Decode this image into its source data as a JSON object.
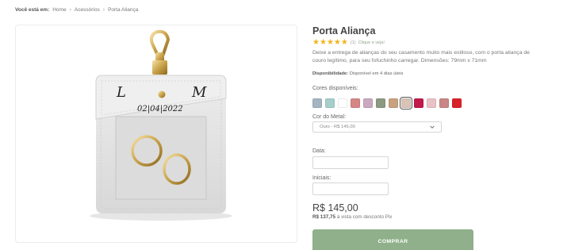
{
  "breadcrumb": {
    "lead": "Você está em:",
    "items": [
      "Home",
      "Acessórios",
      "Porta Aliança"
    ]
  },
  "product": {
    "title": "Porta Aliança",
    "rating": {
      "stars": 5,
      "count": "(1)",
      "review_link": "Clique e veja!"
    },
    "description": "Deixe a entrega de alianças do seu casamento muito mais estiloso, com o porta aliança de couro legítimo, para seu fofuchinho carregar. Dimensões: 79mm x 71mm",
    "availability_label": "Disponibilidade:",
    "availability_value": "Disponível em 4 dias úteis",
    "image_engraving": {
      "initial_left": "L",
      "initial_right": "M",
      "date": "02|04|2022"
    }
  },
  "colors": {
    "label": "Cores disponíveis:",
    "selected_index": 7,
    "swatches": [
      "#a5b4c2",
      "#a6cfcb",
      "#ffffff",
      "#d68585",
      "#c9a9bf",
      "#8c9a82",
      "#c9a17f",
      "#d9c4b5",
      "#c21a4a",
      "#e8c2c4",
      "#c98686",
      "#d92128"
    ]
  },
  "metal": {
    "label": "Cor do Metal:",
    "value": "Ouro - R$ 145,00"
  },
  "fields": {
    "date_label": "Data:",
    "date_value": "",
    "initials_label": "Iniciais:",
    "initials_value": ""
  },
  "pricing": {
    "price": "R$ 145,00",
    "pix_price": "R$ 137,75",
    "pix_text": "à vista com desconto Pix"
  },
  "buy_label": "COMPRAR",
  "theme": {
    "accent": "#8fb08a",
    "star": "#f2b51c"
  }
}
